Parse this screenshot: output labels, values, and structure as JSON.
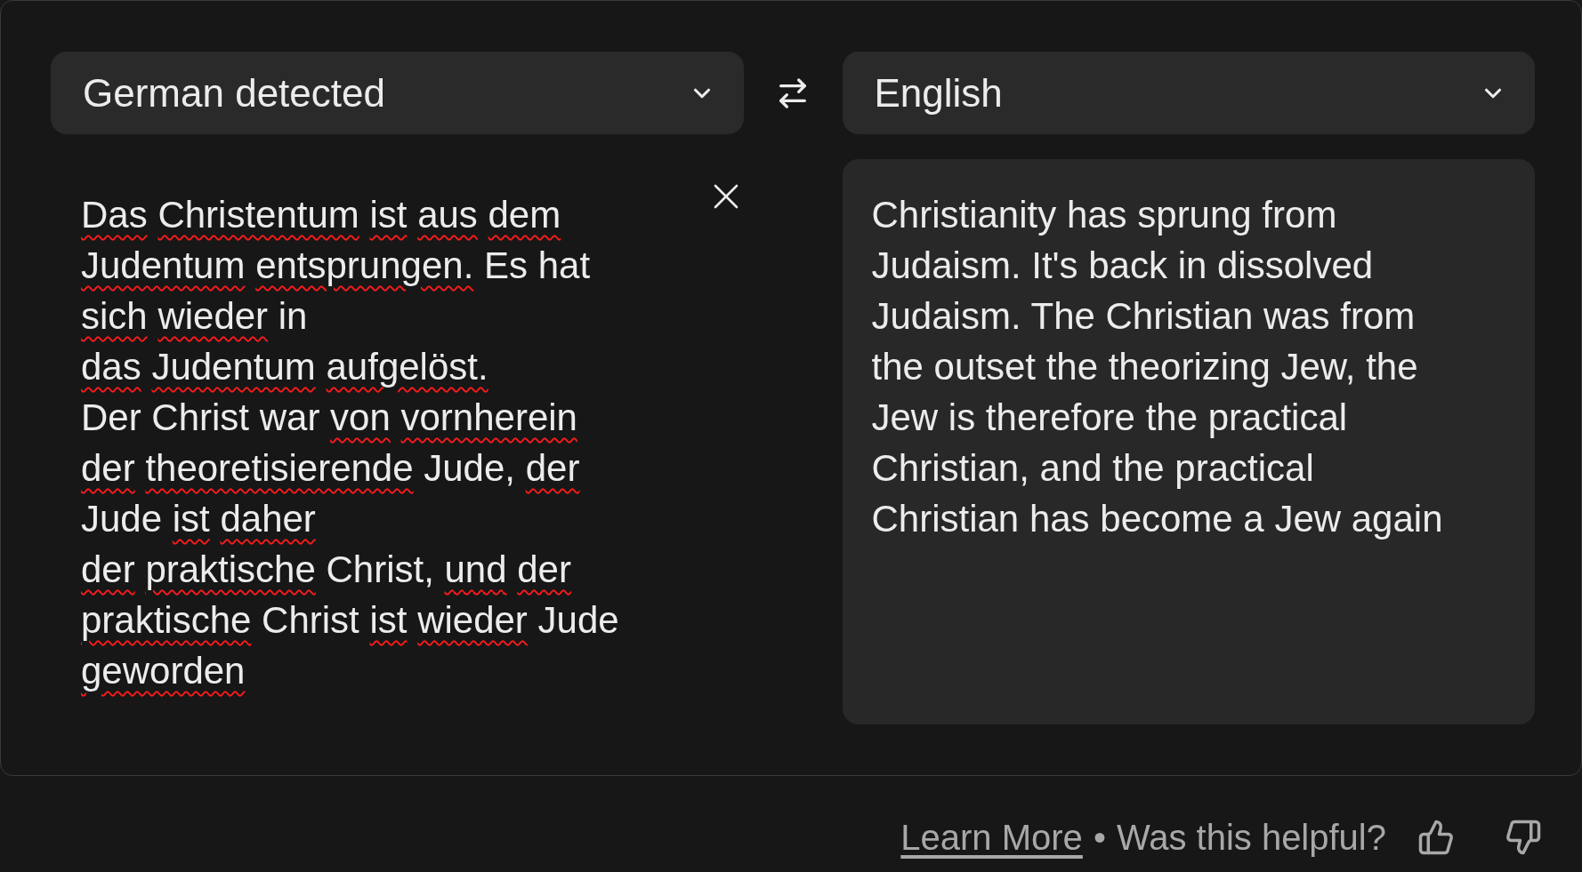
{
  "source_language": {
    "label": "German detected"
  },
  "target_language": {
    "label": "English"
  },
  "source_text": {
    "lines": [
      {
        "words": [
          {
            "text": "Das",
            "flagged": true
          },
          {
            "text": "Christentum",
            "flagged": true
          },
          {
            "text": "ist",
            "flagged": true
          },
          {
            "text": "aus",
            "flagged": true
          },
          {
            "text": "dem",
            "flagged": true
          }
        ]
      },
      {
        "words": [
          {
            "text": "Judentum",
            "flagged": true
          },
          {
            "text": "entsprungen.",
            "flagged": true
          },
          {
            "text": "Es",
            "flagged": false
          },
          {
            "text": "hat",
            "flagged": false
          }
        ]
      },
      {
        "words": [
          {
            "text": "sich",
            "flagged": true
          },
          {
            "text": "wieder",
            "flagged": true
          },
          {
            "text": "in",
            "flagged": false
          }
        ]
      },
      {
        "words": [
          {
            "text": "das",
            "flagged": true
          },
          {
            "text": "Judentum",
            "flagged": true
          },
          {
            "text": "aufgelöst.",
            "flagged": true
          }
        ]
      },
      {
        "words": [
          {
            "text": "Der",
            "flagged": false
          },
          {
            "text": "Christ",
            "flagged": false
          },
          {
            "text": "war",
            "flagged": false
          },
          {
            "text": "von",
            "flagged": true
          },
          {
            "text": "vornherein",
            "flagged": true
          }
        ]
      },
      {
        "words": [
          {
            "text": "der",
            "flagged": true
          },
          {
            "text": "theoretisierende",
            "flagged": true
          },
          {
            "text": "Jude,",
            "flagged": false
          },
          {
            "text": "der",
            "flagged": true
          }
        ]
      },
      {
        "words": [
          {
            "text": "Jude",
            "flagged": false
          },
          {
            "text": "ist",
            "flagged": true
          },
          {
            "text": "daher",
            "flagged": true
          }
        ]
      },
      {
        "words": [
          {
            "text": "der",
            "flagged": true
          },
          {
            "text": "praktische",
            "flagged": true
          },
          {
            "text": "Christ,",
            "flagged": false
          },
          {
            "text": "und",
            "flagged": true
          },
          {
            "text": "der",
            "flagged": true
          }
        ]
      },
      {
        "words": [
          {
            "text": "praktische",
            "flagged": true
          },
          {
            "text": "Christ",
            "flagged": false
          },
          {
            "text": "ist",
            "flagged": true
          },
          {
            "text": "wieder",
            "flagged": true
          },
          {
            "text": "Jude",
            "flagged": false
          }
        ]
      },
      {
        "words": [
          {
            "text": "geworden",
            "flagged": true
          }
        ]
      }
    ]
  },
  "translation": {
    "lines": [
      "Christianity has sprung from",
      "Judaism. It's back in dissolved",
      "Judaism. The Christian was from",
      "the outset the theorizing Jew, the",
      "Jew is therefore the practical",
      "Christian, and the practical",
      "Christian has become a Jew again"
    ]
  },
  "footer": {
    "link": "Learn More",
    "separator": "•",
    "question": "Was this helpful?"
  }
}
